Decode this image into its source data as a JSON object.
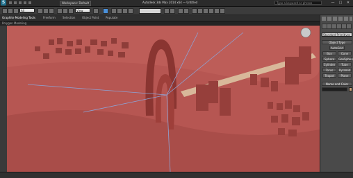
{
  "title_bar": {
    "app_logo": "S",
    "workspace": "Workspace: Default",
    "title": "Autodesk 3ds Max 2014  x64  —  Untitled",
    "search_placeholder": "Type a keyword or phrase",
    "minimize": "—",
    "maximize": "□",
    "close": "✕"
  },
  "toolbar": {
    "selection_filter": "All",
    "view_dropdown": "View"
  },
  "ribbon": {
    "tabs": [
      "Graphite Modeling Tools",
      "Freeform",
      "Selection",
      "Object Paint",
      "Populate"
    ],
    "sub_label": "Polygon Modeling"
  },
  "viewport": {
    "label": "",
    "scene_color": "#b65652"
  },
  "command_panel": {
    "category_dropdown": "Standard Primitives",
    "object_type_header": "Object Type",
    "auto_grid": "AutoGrid",
    "buttons": [
      "Box",
      "Cone",
      "Sphere",
      "GeoSphere",
      "Cylinder",
      "Tube",
      "Torus",
      "Pyramid",
      "Teapot",
      "Plane"
    ],
    "name_color_header": "Name and Color"
  }
}
